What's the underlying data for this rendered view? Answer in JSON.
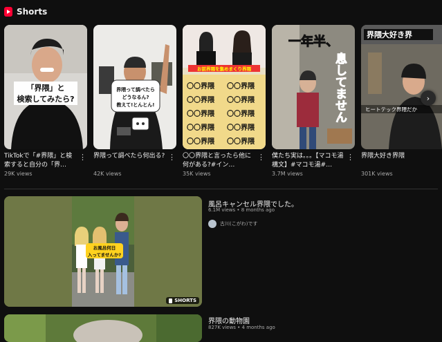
{
  "section": {
    "title": "Shorts"
  },
  "shorts": [
    {
      "title": "TikTokで「#界隈」と検索すると自分の「界…",
      "views": "29K views",
      "overlay": "「界隈」と\n検索してみたら?"
    },
    {
      "title": "界隈って調べたら何出る?",
      "views": "42K views",
      "overlay": "界隈って調べたら\nどうなるん?\n教えて!とんとん!"
    },
    {
      "title": "〇〇界隈と言ったら他に何がある?#イン…",
      "views": "35K views",
      "overlay_top": "お前界隈を集めまくり界隈",
      "grid": "〇〇界隈"
    },
    {
      "title": "僕たち実は。。。【マコモ湯構文】#マコモ湯#…",
      "views": "3.7M views",
      "overlay_a": "一年半、",
      "overlay_b": "息してません"
    },
    {
      "title": "界隈大好き界隈",
      "views": "301K views",
      "overlay_top": "界隈大好き界",
      "overlay_mid": "ヒートテック界隈だか"
    }
  ],
  "kebab": "⋮",
  "next": "›",
  "videos": [
    {
      "title": "風呂キャンセル界隈でした。",
      "meta": "6.1M views • 8 months ago",
      "channel": "古川(こがわ)です",
      "badge": "SHORTS",
      "overlay": "お風呂何日\n入ってませんか?"
    },
    {
      "title": "界隈の動物園",
      "meta": "827K views • 4 months ago"
    }
  ],
  "colors": {
    "accent": "#ff0033",
    "bg": "#0f0f0f"
  }
}
